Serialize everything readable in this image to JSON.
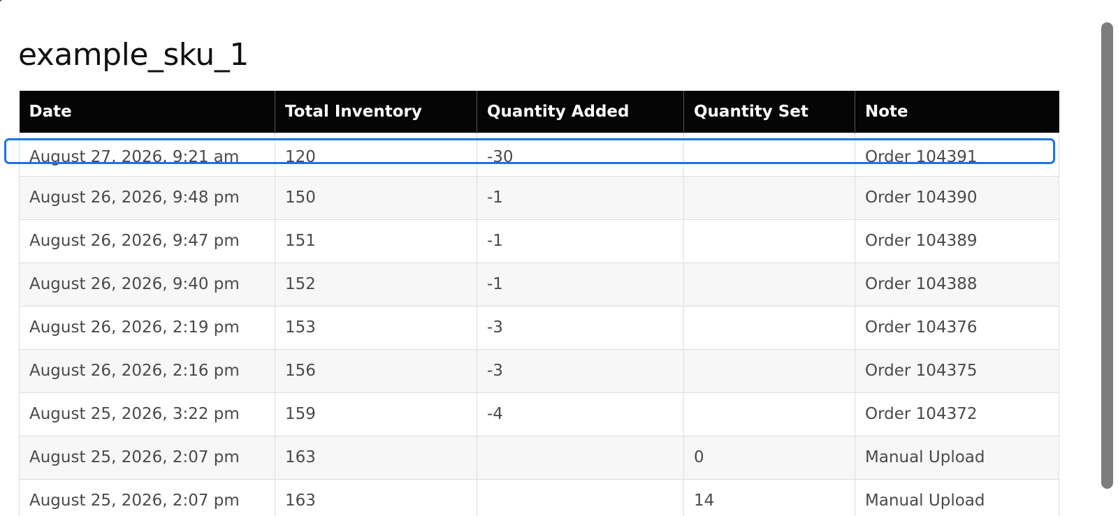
{
  "modal": {
    "title": "example_sku_1"
  },
  "table": {
    "columns": [
      "Date",
      "Total Inventory",
      "Quantity Added",
      "Quantity Set",
      "Note"
    ],
    "rows": [
      {
        "date": "August 27, 2026, 9:21 am",
        "total": "120",
        "added": "-30",
        "set": "",
        "note": "Order 104391"
      },
      {
        "date": "August 26, 2026, 9:48 pm",
        "total": "150",
        "added": "-1",
        "set": "",
        "note": "Order 104390"
      },
      {
        "date": "August 26, 2026, 9:47 pm",
        "total": "151",
        "added": "-1",
        "set": "",
        "note": "Order 104389"
      },
      {
        "date": "August 26, 2026, 9:40 pm",
        "total": "152",
        "added": "-1",
        "set": "",
        "note": "Order 104388"
      },
      {
        "date": "August 26, 2026, 2:19 pm",
        "total": "153",
        "added": "-3",
        "set": "",
        "note": "Order 104376"
      },
      {
        "date": "August 26, 2026, 2:16 pm",
        "total": "156",
        "added": "-3",
        "set": "",
        "note": "Order 104375"
      },
      {
        "date": "August 25, 2026, 3:22 pm",
        "total": "159",
        "added": "-4",
        "set": "",
        "note": "Order 104372"
      },
      {
        "date": "August 25, 2026, 2:07 pm",
        "total": "163",
        "added": "",
        "set": "0",
        "note": "Manual Upload"
      },
      {
        "date": "August 25, 2026, 2:07 pm",
        "total": "163",
        "added": "",
        "set": "14",
        "note": "Manual Upload"
      }
    ]
  },
  "colors": {
    "header_bg": "#050505",
    "highlight": "#1a73e8"
  }
}
